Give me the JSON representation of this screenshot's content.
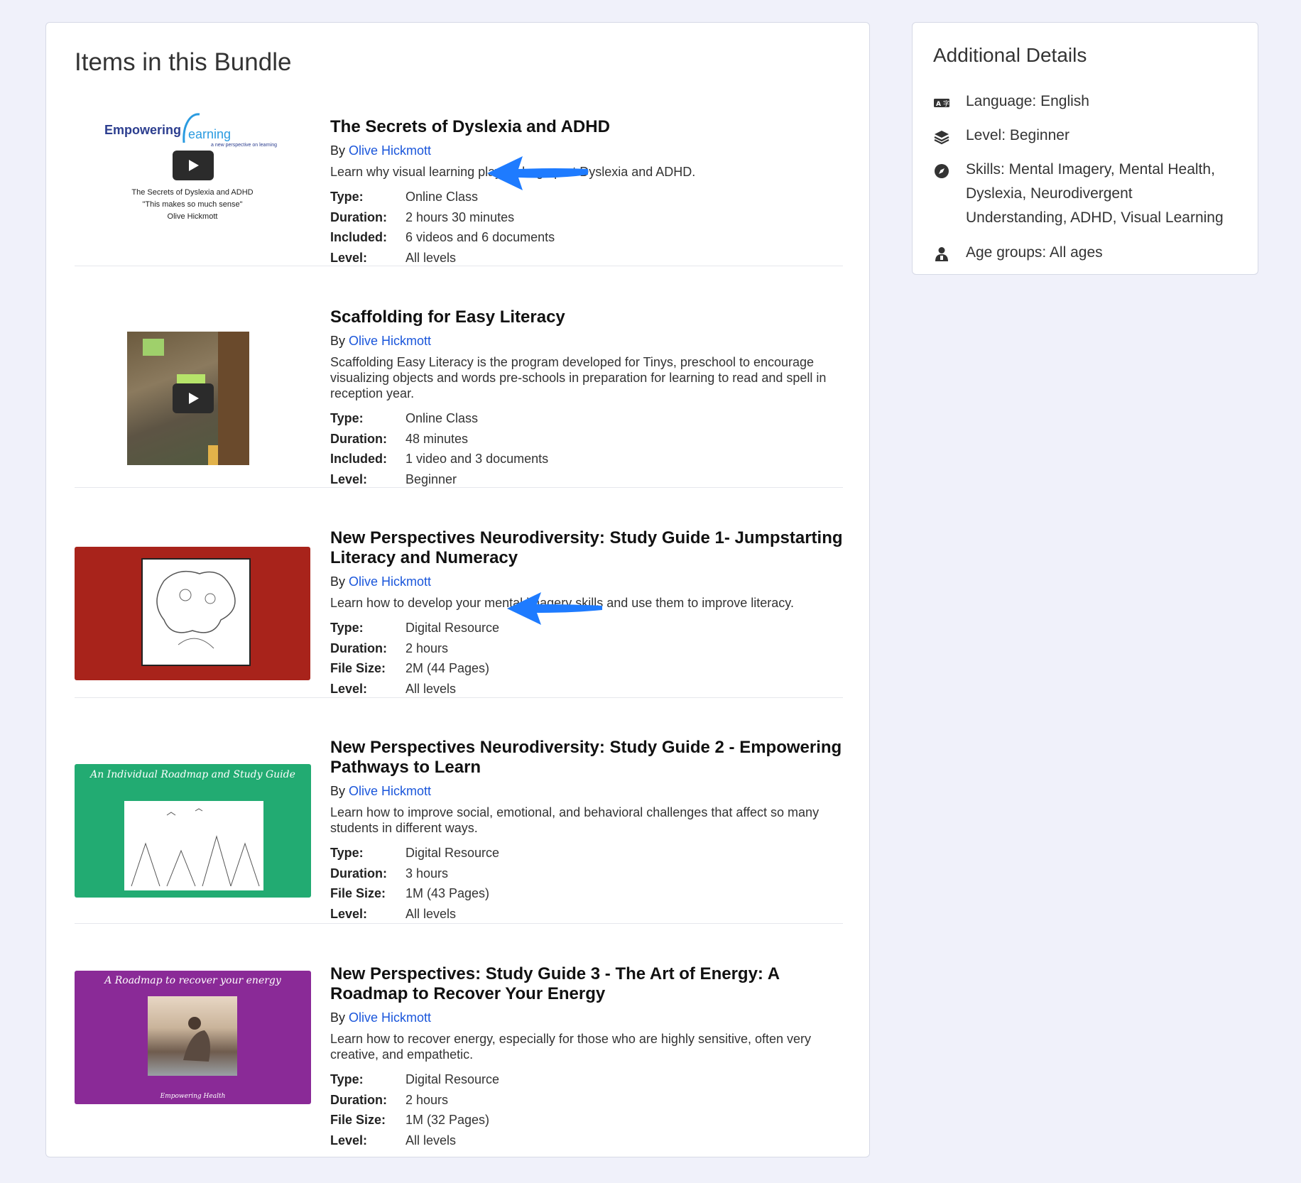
{
  "bundle": {
    "title": "Items in this Bundle",
    "by_label": "By",
    "items": [
      {
        "title": "The Secrets of Dyslexia and ADHD",
        "author": "Olive Hickmott",
        "description": "Learn why visual learning plays a large part Dyslexia and ADHD.",
        "meta": [
          {
            "key": "Type:",
            "value": "Online Class"
          },
          {
            "key": "Duration:",
            "value": "2 hours 30 minutes"
          },
          {
            "key": "Included:",
            "value": "6 videos and 6 documents"
          },
          {
            "key": "Level:",
            "value": "All levels"
          }
        ],
        "thumb": {
          "brand": "Empowering",
          "brand2": "earning",
          "tagline": "a new perspective on learning",
          "line1": "The Secrets of Dyslexia and ADHD",
          "line2": "\"This makes so much sense\"",
          "line3": "Olive Hickmott"
        }
      },
      {
        "title": "Scaffolding for Easy Literacy",
        "author": "Olive Hickmott",
        "description": "Scaffolding Easy Literacy is the program developed for Tinys, preschool to encourage visualizing objects and words pre-schools in preparation for learning to read and spell in reception year.",
        "meta": [
          {
            "key": "Type:",
            "value": "Online Class"
          },
          {
            "key": "Duration:",
            "value": "48 minutes"
          },
          {
            "key": "Included:",
            "value": "1 video and 3 documents"
          },
          {
            "key": "Level:",
            "value": "Beginner"
          }
        ]
      },
      {
        "title": "New Perspectives Neurodiversity: Study Guide 1- Jumpstarting Literacy and Numeracy",
        "author": "Olive Hickmott",
        "description": "Learn how to develop your mental imagery skills and use them to improve literacy.",
        "meta": [
          {
            "key": "Type:",
            "value": "Digital Resource"
          },
          {
            "key": "Duration:",
            "value": "2 hours"
          },
          {
            "key": "File Size:",
            "value": "2M (44 Pages)"
          },
          {
            "key": "Level:",
            "value": "All levels"
          }
        ]
      },
      {
        "title": "New Perspectives Neurodiversity: Study Guide 2 - Empowering Pathways to Learn",
        "author": "Olive Hickmott",
        "description": "Learn how to improve social, emotional, and behavioral challenges that affect so many students in different ways.",
        "meta": [
          {
            "key": "Type:",
            "value": "Digital Resource"
          },
          {
            "key": "Duration:",
            "value": "3 hours"
          },
          {
            "key": "File Size:",
            "value": "1M (43 Pages)"
          },
          {
            "key": "Level:",
            "value": "All levels"
          }
        ],
        "thumb": {
          "caption": "An Individual Roadmap and Study Guide"
        }
      },
      {
        "title": "New Perspectives: Study Guide 3 - The Art of Energy: A Roadmap to Recover Your Energy",
        "author": "Olive Hickmott",
        "description": "Learn how to recover energy, especially for those who are highly sensitive, often very creative, and empathetic.",
        "meta": [
          {
            "key": "Type:",
            "value": "Digital Resource"
          },
          {
            "key": "Duration:",
            "value": "2 hours"
          },
          {
            "key": "File Size:",
            "value": "1M (32 Pages)"
          },
          {
            "key": "Level:",
            "value": "All levels"
          }
        ],
        "thumb": {
          "caption": "A Roadmap to recover your energy",
          "footer": "Empowering Health"
        }
      }
    ]
  },
  "details": {
    "title": "Additional Details",
    "language": "Language: English",
    "level": "Level: Beginner",
    "skills": "Skills: Mental Imagery, Mental Health, Dyslexia, Neurodivergent Understanding, ADHD, Visual Learning",
    "age_groups": "Age groups: All ages",
    "icons": [
      "translate-icon",
      "layers-icon",
      "compass-icon",
      "person-icon"
    ]
  },
  "colors": {
    "link": "#1a56db",
    "arrow": "#1e7bff",
    "thumb_red": "#a8231b",
    "thumb_green": "#22ab72",
    "thumb_purple": "#8a2a97",
    "page_bg": "#f0f1fa"
  }
}
